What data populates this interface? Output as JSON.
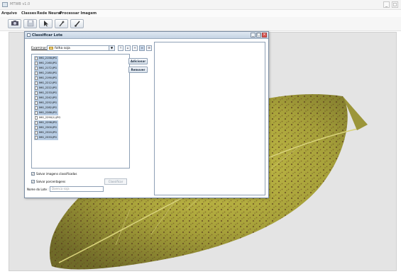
{
  "window": {
    "title": "MTWB v1.0",
    "controls": [
      "_",
      "□"
    ]
  },
  "menubar": {
    "items": [
      "Arquivo",
      "Classes",
      "Rede Neural",
      "Processar Imagem"
    ]
  },
  "toolbar": {
    "buttons": [
      "camera-icon",
      "save-icon",
      "pointer-icon",
      "wand-icon",
      "brush-icon"
    ]
  },
  "dialog": {
    "title": "Classificar Lote",
    "look_in_label": "Examinar:",
    "look_in_value": "folha soja",
    "fc_buttons": [
      "up-folder-icon",
      "home-icon",
      "new-folder-icon",
      "list-view-icon",
      "details-view-icon"
    ],
    "files": [
      {
        "name": "IMG_2158.JPG",
        "selected": true
      },
      {
        "name": "IMG_2160.JPG",
        "selected": true
      },
      {
        "name": "IMG_2172.JPG",
        "selected": true
      },
      {
        "name": "IMG_2180.JPG",
        "selected": true
      },
      {
        "name": "IMG_2190.JPG",
        "selected": true
      },
      {
        "name": "IMG_2212.JPG",
        "selected": true
      },
      {
        "name": "IMG_2222.JPG",
        "selected": true
      },
      {
        "name": "IMG_2233.JPG",
        "selected": true
      },
      {
        "name": "IMG_2242.JPG",
        "selected": true
      },
      {
        "name": "IMG_2252.JPG",
        "selected": true
      },
      {
        "name": "IMG_2282.JPG",
        "selected": true
      },
      {
        "name": "IMG_2288.JPG",
        "selected": true
      },
      {
        "name": "IMG_2290(1).JPG",
        "selected": false
      },
      {
        "name": "IMG_2298.JPG",
        "selected": true
      },
      {
        "name": "IMG_2300.JPG",
        "selected": true
      },
      {
        "name": "IMG_2320.JPG",
        "selected": true
      },
      {
        "name": "IMG_2333.JPG",
        "selected": true
      }
    ],
    "add_button": "Adicionar",
    "remove_button": "Remover",
    "save_images_label": "Salvar imagens classificadas",
    "save_images_checked": true,
    "save_percent_label": "Salvar porcentagens",
    "save_percent_checked": true,
    "classify_button": "Classificar",
    "lot_name_label": "Nome do Lote :",
    "lot_name_placeholder": "Doenca soja"
  },
  "colors": {
    "selection": "#b7cce3",
    "dialog_border": "#7b8da3",
    "close_button": "#d9534f"
  }
}
